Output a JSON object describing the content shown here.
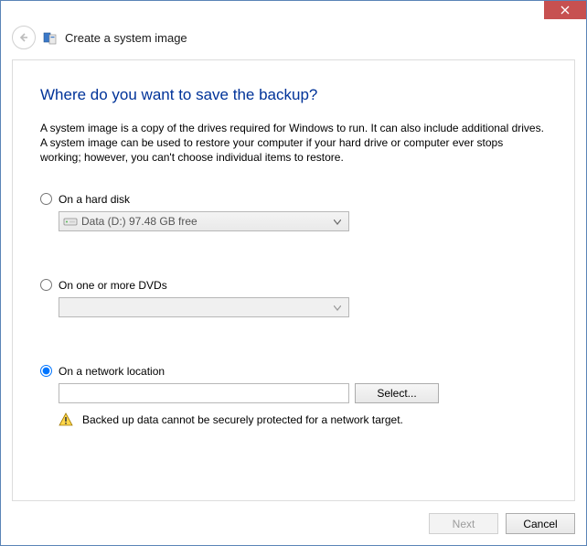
{
  "header": {
    "title": "Create a system image"
  },
  "content": {
    "question": "Where do you want to save the backup?",
    "description": "A system image is a copy of the drives required for Windows to run. It can also include additional drives. A system image can be used to restore your computer if your hard drive or computer ever stops working; however, you can't choose individual items to restore."
  },
  "options": {
    "hard_disk": {
      "label": "On a hard disk",
      "selected_drive": "Data (D:)  97.48 GB free"
    },
    "dvd": {
      "label": "On one or more DVDs",
      "selected": ""
    },
    "network": {
      "label": "On a network location",
      "path": "",
      "select_button": "Select...",
      "warning": "Backed up data cannot be securely protected for a network target."
    }
  },
  "footer": {
    "next": "Next",
    "cancel": "Cancel"
  }
}
